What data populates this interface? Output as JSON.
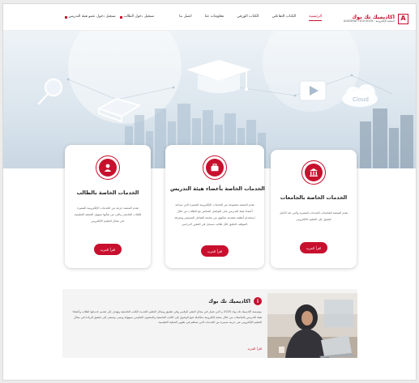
{
  "brand": {
    "title": "اكاديميك تك بوك",
    "subtitle": "ACADEMIC TECH BOOK · المكتبة الإلكترونية",
    "mark": "A",
    "accent": "#c8102e"
  },
  "nav": {
    "items": [
      {
        "label": "الرئيسية",
        "active": true
      },
      {
        "label": "الكتاب التفاعلي",
        "active": false
      },
      {
        "label": "الكتاب الورقي",
        "active": false
      },
      {
        "label": "معلومات عنا",
        "active": false
      },
      {
        "label": "اتصل بنا",
        "active": false
      }
    ]
  },
  "auth": {
    "student_login": "تسجيل دخول الطالب",
    "faculty_login": "تسجيل دخول عضو هيئة التدريس"
  },
  "hero": {
    "cloud_label": "Cloud"
  },
  "cards": [
    {
      "title": "الخدمات الخاصة بالطالب",
      "description": "تقدم المنصة حزمة من الخدمات الإلكترونية المميزة للكتاب الجامعي والتي من شأنها تسهيل العملية التعليمية في مجال التعليم الالكتروني.",
      "button": "اقرأ المزيد",
      "icon": "student-icon"
    },
    {
      "title": "الخدمات الخاصة بأعضاء هيئة التدريس",
      "description": "تقدم المنصة مجموعة من الخدمات الإلكترونية المميزة التي تساعد أعضاء هيئة التدريس على التواصل المباشر مع الطلاب من خلال استخدام أنظمة متقدمة تمكنهم من متابعة التفاعل المستمر ومعرفة الموقف الدقيق لكل طالب مسجل في المقرر الدراسي.",
      "button": "اقرأ المزيد",
      "icon": "briefcase-icon"
    },
    {
      "title": "الخدمات الخاصة بالجامعات",
      "description": "تقدم المنصة للجامعات الخدمات المميزة والتي تعد الأمثل للتحول إلى التعليم الالكتروني",
      "button": "اقرأ المزيد",
      "icon": "university-icon"
    }
  ],
  "about": {
    "badge": "i",
    "title": "اكاديميك تك بوك",
    "text": "مؤسسة اكاديميك تك بوك 2020 م التي تعمل في مجال النشر الرقمي وفي تطبيق وسائل التعليم الحديث للكتب الجامعية وتهدف إلى تقديم خدماتها لطلاب وأعضاء هيئة التدريس بالجامعات من خلال منصة إلكترونية متكاملة تتيح الوصول إلى الكتب الجامعية والمحتوى التعليمي بسهولة ويسر، وتسعى إلى تحقيق الريادة في مجال التعليم الإلكتروني عبر حزمة متميزة من الخدمات التي تساهم في تطوير العملية التعليمية.",
    "more": "اقرأ المزيد"
  }
}
